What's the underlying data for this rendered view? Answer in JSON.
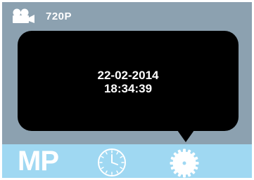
{
  "status_bar": {
    "mode_icon": "video-camera-icon",
    "resolution": "720P"
  },
  "popup": {
    "date": "22-02-2014",
    "time": "18:34:39"
  },
  "bottom_bar": {
    "mode_label": "MP",
    "time_setting_icon": "clock-icon",
    "settings_icon": "gear-icon",
    "active_icon": "gear-icon"
  },
  "colors": {
    "screen_bg": "#8ca1b0",
    "bottom_bar_bg": "#9fd8f2",
    "popup_bg": "#000000",
    "text": "#ffffff"
  }
}
